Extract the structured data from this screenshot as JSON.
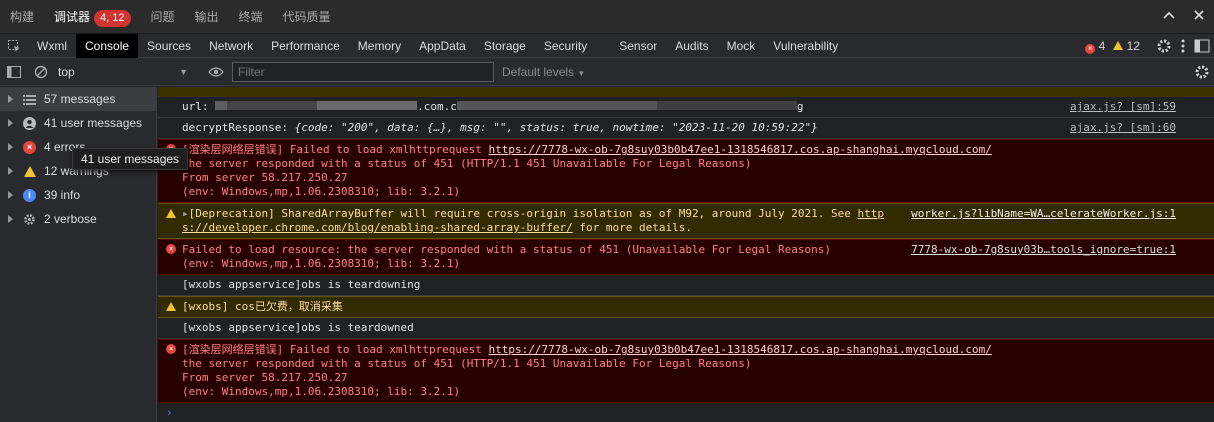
{
  "top_tabs": [
    "构建",
    "调试器",
    "问题",
    "输出",
    "终端",
    "代码质量"
  ],
  "top_badge": "4, 12",
  "top_icons": [
    "chevron-up-icon",
    "close-icon"
  ],
  "tabs": [
    "Wxml",
    "Console",
    "Sources",
    "Network",
    "Performance",
    "Memory",
    "AppData",
    "Storage",
    "Security",
    "Sensor",
    "Audits",
    "Mock",
    "Vulnerability"
  ],
  "active_tab": "Console",
  "counts": {
    "errors": "4",
    "warnings": "12"
  },
  "filter": {
    "context": "top",
    "placeholder": "Filter",
    "value": "Filter",
    "levels": "Default levels"
  },
  "sidebar": [
    {
      "icon": "list-icon",
      "label": "57 messages"
    },
    {
      "icon": "user-icon",
      "label": "41 user messages"
    },
    {
      "icon": "error-icon",
      "label": "4 errors"
    },
    {
      "icon": "warning-icon",
      "label": "12 warnings"
    },
    {
      "icon": "info-icon",
      "label": "39 info"
    },
    {
      "icon": "gear-icon",
      "label": "2 verbose"
    }
  ],
  "tooltip": "41 user messages",
  "console": {
    "url_key": "url:",
    "url_fragment": ".com.c",
    "url_tail": "g",
    "url_src": "ajax.js? [sm]:59",
    "decrypt_key": "decryptResponse:",
    "decrypt_value": "{code: \"200\", data: {…}, msg: \"\", status: true, nowtime: \"2023-11-20 10:59:22\"}",
    "decrypt_src": "ajax.js? [sm]:60",
    "err1": {
      "prefix": "[渲染层网络层错误] Failed to load xmlhttprequest ",
      "link": "https://7778-wx-ob-7g8suy03b0b47ee1-1318546817.cos.ap-shanghai.myqcloud.com/",
      "line2": "the server responded with a status of 451 (HTTP/1.1 451 Unavailable For Legal Reasons)",
      "line3": "From server 58.217.250.27",
      "line4": "(env: Windows,mp,1.06.2308310; lib: 3.2.1)"
    },
    "warn1": {
      "text": "[Deprecation] SharedArrayBuffer will require cross-origin isolation as of M92, around July 2021. See ",
      "link1": "http",
      "link2": "s://developer.chrome.com/blog/enabling-shared-array-buffer/",
      "tail": " for more details.",
      "src": "worker.js?libName=WA…celerateWorker.js:1"
    },
    "err2": {
      "line1": "Failed to load resource: the server responded with a status of 451 (Unavailable For Legal Reasons)",
      "line2": "(env: Windows,mp,1.06.2308310; lib: 3.2.1)",
      "src": "7778-wx-ob-7g8suy03b…tools_ignore=true:1"
    },
    "log1": "[wxobs appservice]obs is teardowning",
    "warn2": "[wxobs] cos已欠费，取消采集",
    "log2": "[wxobs appservice]obs is teardowned",
    "err3": {
      "prefix": "[渲染层网络层错误] Failed to load xmlhttprequest ",
      "link": "https://7778-wx-ob-7g8suy03b0b47ee1-1318546817.cos.ap-shanghai.myqcloud.com/",
      "line2": "the server responded with a status of 451 (HTTP/1.1 451 Unavailable For Legal Reasons)",
      "line3": "From server 58.217.250.27",
      "line4": "(env: Windows,mp,1.06.2308310; lib: 3.2.1)"
    },
    "prompt": "›"
  }
}
